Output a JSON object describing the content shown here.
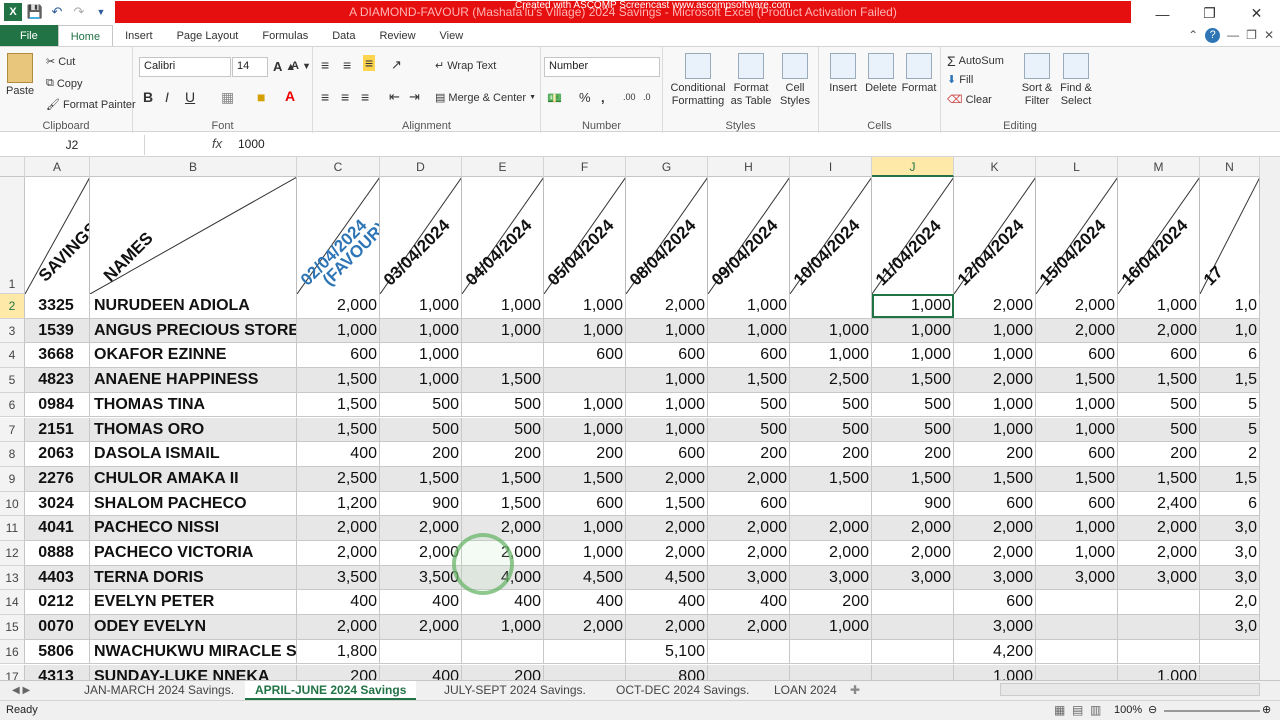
{
  "title": {
    "text": "A DIAMOND-FAVOUR (Mashafa'lu's Village) 2024 Savings - Microsoft Excel (Product Activation Failed)",
    "watermark": "Created with ASCOMP Screencast www.ascompsoftware.com"
  },
  "tabs": [
    "File",
    "Home",
    "Insert",
    "Page Layout",
    "Formulas",
    "Data",
    "Review",
    "View"
  ],
  "ribbon": {
    "clipboard": {
      "paste": "Paste",
      "cut": "Cut",
      "copy": "Copy",
      "format_painter": "Format Painter",
      "label": "Clipboard"
    },
    "font": {
      "name": "Calibri",
      "size": "14",
      "label": "Font"
    },
    "alignment": {
      "wrap": "Wrap Text",
      "merge": "Merge & Center",
      "label": "Alignment"
    },
    "number": {
      "format": "Number",
      "label": "Number"
    },
    "styles": {
      "conditional": "Conditional Formatting",
      "format_table": "Format as Table",
      "cell_styles": "Cell Styles",
      "label": "Styles"
    },
    "cells": {
      "insert": "Insert",
      "delete": "Delete",
      "format": "Format",
      "label": "Cells"
    },
    "editing": {
      "autosum": "AutoSum",
      "fill": "Fill",
      "clear": "Clear",
      "sort": "Sort & Filter",
      "find": "Find & Select",
      "label": "Editing"
    }
  },
  "formula_bar": {
    "name_box": "J2",
    "fx": "fx",
    "value": "1000"
  },
  "columns": [
    "A",
    "B",
    "C",
    "D",
    "E",
    "F",
    "G",
    "H",
    "I",
    "J",
    "K",
    "L",
    "M",
    "N"
  ],
  "selected_column": "J",
  "header_row": {
    "savings": "SAVINGS",
    "names": "NAMES",
    "dates": [
      "02/04/2024\n(FAVOUR)",
      "03/04/2024",
      "04/04/2024",
      "05/04/2024",
      "08/04/2024",
      "09/04/2024",
      "10/04/2024",
      "11/04/2024",
      "12/04/2024",
      "15/04/2024",
      "16/04/2024",
      "17"
    ]
  },
  "row_numbers": [
    "1",
    "2",
    "3",
    "4",
    "5",
    "6",
    "7",
    "8",
    "9",
    "10",
    "11",
    "12",
    "13",
    "14",
    "15",
    "16",
    "17"
  ],
  "rows": [
    {
      "code": "3325",
      "name": "NURUDEEN ADIOLA",
      "vals": [
        "2,000",
        "1,000",
        "1,000",
        "1,000",
        "2,000",
        "1,000",
        "",
        "1,000",
        "2,000",
        "2,000",
        "1,000",
        "1,0"
      ]
    },
    {
      "code": "1539",
      "name": "ANGUS PRECIOUS STORE",
      "vals": [
        "1,000",
        "1,000",
        "1,000",
        "1,000",
        "1,000",
        "1,000",
        "1,000",
        "1,000",
        "1,000",
        "2,000",
        "2,000",
        "1,0"
      ]
    },
    {
      "code": "3668",
      "name": "OKAFOR EZINNE",
      "vals": [
        "600",
        "1,000",
        "",
        "600",
        "600",
        "600",
        "1,000",
        "1,000",
        "1,000",
        "600",
        "600",
        "6"
      ]
    },
    {
      "code": "4823",
      "name": "ANAENE HAPPINESS",
      "vals": [
        "1,500",
        "1,000",
        "1,500",
        "",
        "1,000",
        "1,500",
        "2,500",
        "1,500",
        "2,000",
        "1,500",
        "1,500",
        "1,5"
      ]
    },
    {
      "code": "0984",
      "name": "THOMAS TINA",
      "vals": [
        "1,500",
        "500",
        "500",
        "1,000",
        "1,000",
        "500",
        "500",
        "500",
        "1,000",
        "1,000",
        "500",
        "5"
      ]
    },
    {
      "code": "2151",
      "name": "THOMAS ORO",
      "vals": [
        "1,500",
        "500",
        "500",
        "1,000",
        "1,000",
        "500",
        "500",
        "500",
        "1,000",
        "1,000",
        "500",
        "5"
      ]
    },
    {
      "code": "2063",
      "name": "DASOLA ISMAIL",
      "vals": [
        "400",
        "200",
        "200",
        "200",
        "600",
        "200",
        "200",
        "200",
        "200",
        "600",
        "200",
        "2"
      ]
    },
    {
      "code": "2276",
      "name": "CHULOR AMAKA II",
      "vals": [
        "2,500",
        "1,500",
        "1,500",
        "1,500",
        "2,000",
        "2,000",
        "1,500",
        "1,500",
        "1,500",
        "1,500",
        "1,500",
        "1,5"
      ]
    },
    {
      "code": "3024",
      "name": "SHALOM PACHECO",
      "vals": [
        "1,200",
        "900",
        "1,500",
        "600",
        "1,500",
        "600",
        "",
        "900",
        "600",
        "600",
        "2,400",
        "6"
      ]
    },
    {
      "code": "4041",
      "name": "PACHECO NISSI",
      "vals": [
        "2,000",
        "2,000",
        "2,000",
        "1,000",
        "2,000",
        "2,000",
        "2,000",
        "2,000",
        "2,000",
        "1,000",
        "2,000",
        "3,0"
      ]
    },
    {
      "code": "0888",
      "name": "PACHECO VICTORIA",
      "vals": [
        "2,000",
        "2,000",
        "2,000",
        "1,000",
        "2,000",
        "2,000",
        "2,000",
        "2,000",
        "2,000",
        "1,000",
        "2,000",
        "3,0"
      ]
    },
    {
      "code": "4403",
      "name": "TERNA DORIS",
      "vals": [
        "3,500",
        "3,500",
        "4,000",
        "4,500",
        "4,500",
        "3,000",
        "3,000",
        "3,000",
        "3,000",
        "3,000",
        "3,000",
        "3,0"
      ]
    },
    {
      "code": "0212",
      "name": "EVELYN PETER",
      "vals": [
        "400",
        "400",
        "400",
        "400",
        "400",
        "400",
        "200",
        "",
        "600",
        "",
        "",
        "2,0"
      ]
    },
    {
      "code": "0070",
      "name": "ODEY EVELYN",
      "vals": [
        "2,000",
        "2,000",
        "1,000",
        "2,000",
        "2,000",
        "2,000",
        "1,000",
        "",
        "3,000",
        "",
        "",
        "3,0"
      ]
    },
    {
      "code": "5806",
      "name": "NWACHUKWU MIRACLE SU",
      "vals": [
        "1,800",
        "",
        "",
        "",
        "5,100",
        "",
        "",
        "",
        "4,200",
        "",
        "",
        ""
      ]
    },
    {
      "code": "4313",
      "name": "SUNDAY-LUKE NNEKA",
      "vals": [
        "200",
        "400",
        "200",
        "",
        "800",
        "",
        "",
        "",
        "1,000",
        "",
        "1,000",
        ""
      ]
    }
  ],
  "sheet_tabs": [
    "JAN-MARCH 2024 Savings.",
    "APRIL-JUNE 2024 Savings",
    "JULY-SEPT 2024 Savings.",
    "OCT-DEC 2024 Savings.",
    "LOAN 2024"
  ],
  "active_sheet": "APRIL-JUNE 2024 Savings",
  "status": {
    "ready": "Ready",
    "zoom": "100%"
  }
}
